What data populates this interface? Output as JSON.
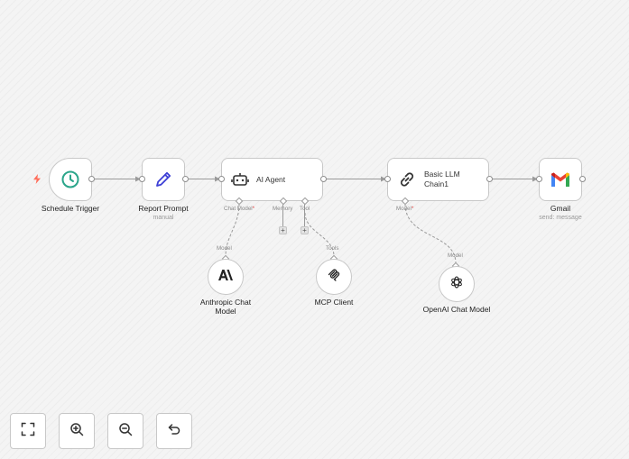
{
  "nodes": {
    "schedule_trigger": {
      "label": "Schedule Trigger"
    },
    "report_prompt": {
      "label": "Report Prompt",
      "sublabel": "manual"
    },
    "ai_agent": {
      "label": "AI Agent",
      "ports": {
        "chat_model": "Chat Model",
        "required_mark": "*",
        "memory": "Memory",
        "tool": "Tool"
      }
    },
    "basic_llm_chain": {
      "label_line1": "Basic LLM",
      "label_line2": "Chain1",
      "ports": {
        "model": "Model",
        "required_mark": "*"
      }
    },
    "gmail": {
      "label": "Gmail",
      "sublabel": "send: message"
    },
    "anthropic": {
      "label_line1": "Anthropic Chat",
      "label_line2": "Model",
      "top_port": "Model"
    },
    "mcp_client": {
      "label": "MCP Client",
      "top_port": "Tools"
    },
    "openai": {
      "label": "OpenAI Chat Model",
      "top_port": "Model"
    }
  },
  "add_buttons": {
    "symbol": "+"
  },
  "controls": [
    "fit-view",
    "zoom-in",
    "zoom-out",
    "undo"
  ],
  "colors": {
    "schedule_icon": "#2aa58a",
    "report_prompt_icon": "#3d3fd6",
    "trigger_bolt": "#ff6d5a",
    "required": "#e0413e",
    "wire": "#9a9a9a"
  }
}
